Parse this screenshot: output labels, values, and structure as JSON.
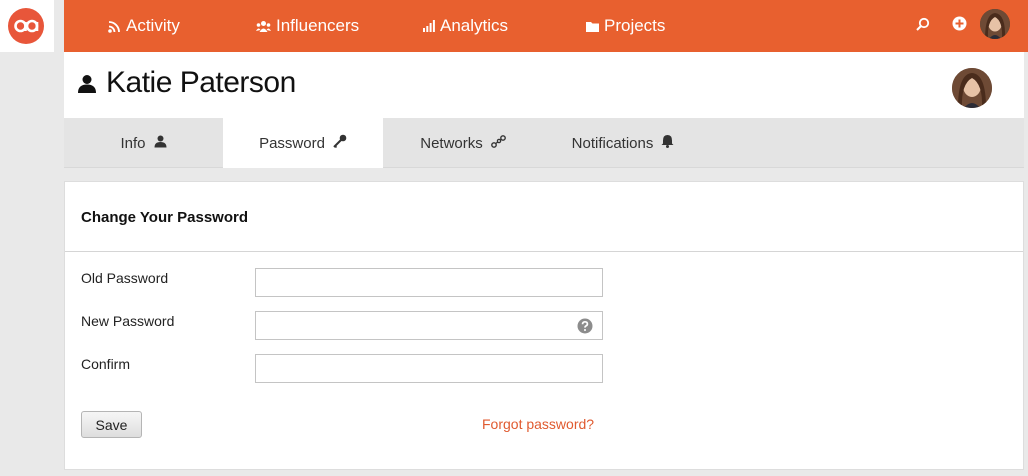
{
  "brand": {
    "logo_icon": "app-logo-icon",
    "accent": "#e8602f"
  },
  "topnav": {
    "items": [
      {
        "label": "Activity",
        "icon": "rss-icon"
      },
      {
        "label": "Influencers",
        "icon": "people-icon"
      },
      {
        "label": "Analytics",
        "icon": "bar-chart-icon"
      },
      {
        "label": "Projects",
        "icon": "folder-icon"
      }
    ],
    "search_icon": "search-icon",
    "add_icon": "plus-circle-icon",
    "avatar": "user-avatar"
  },
  "profile": {
    "name": "Katie Paterson",
    "icon": "user-icon"
  },
  "tabs": [
    {
      "label": "Info",
      "icon": "user-icon",
      "active": false
    },
    {
      "label": "Password",
      "icon": "key-icon",
      "active": true
    },
    {
      "label": "Networks",
      "icon": "link-icon",
      "active": false
    },
    {
      "label": "Notifications",
      "icon": "bell-icon",
      "active": false
    }
  ],
  "password_form": {
    "title": "Change Your Password",
    "fields": [
      {
        "label": "Old Password",
        "value": ""
      },
      {
        "label": "New Password",
        "value": "",
        "help_icon": "question-icon"
      },
      {
        "label": "Confirm",
        "value": ""
      }
    ],
    "save_label": "Save",
    "forgot_label": "Forgot password?"
  }
}
